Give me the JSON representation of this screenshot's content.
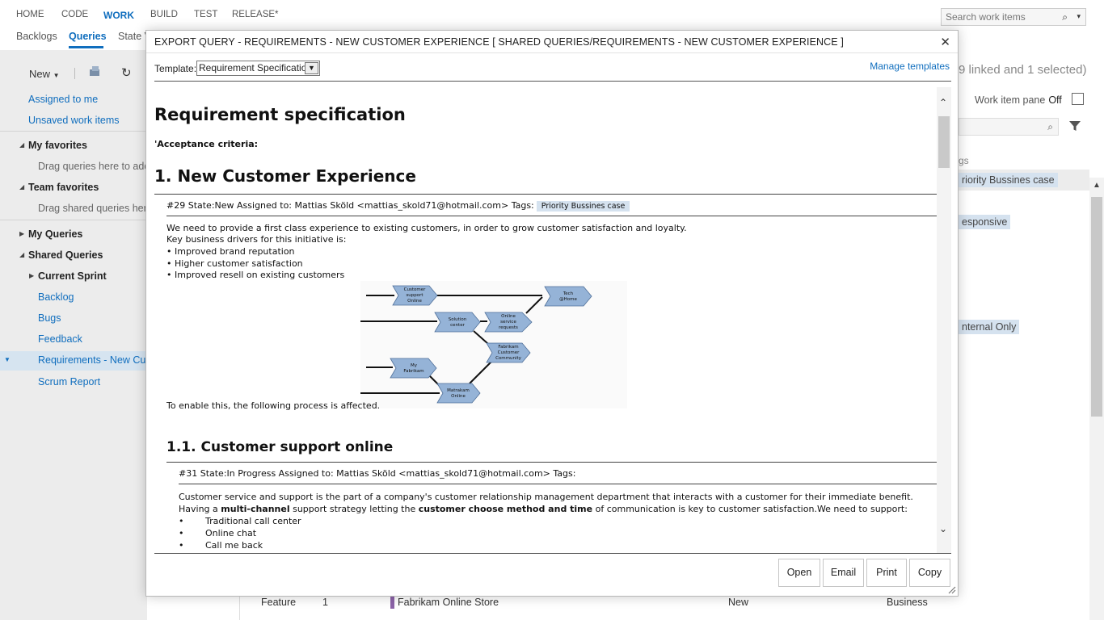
{
  "topnav": {
    "items": [
      "HOME",
      "CODE",
      "WORK",
      "BUILD",
      "TEST",
      "RELEASE*"
    ]
  },
  "search": {
    "placeholder": "Search work items"
  },
  "subnav": {
    "items": [
      "Backlogs",
      "Queries",
      "State V"
    ]
  },
  "sidebar": {
    "new_label": "New",
    "assigned_to_me": "Assigned to me",
    "unsaved": "Unsaved work items",
    "my_favorites": "My favorites",
    "my_fav_hint": "Drag queries here to add",
    "team_favorites": "Team favorites",
    "team_fav_hint": "Drag shared queries here",
    "my_queries": "My Queries",
    "shared_queries": "Shared Queries",
    "current_sprint": "Current Sprint",
    "backlog": "Backlog",
    "bugs": "Bugs",
    "feedback": "Feedback",
    "requirements": "Requirements - New Cus",
    "scrum_report": "Scrum Report"
  },
  "rightpane": {
    "count_text": "9 linked and 1 selected)",
    "wip_label": "Work item pane",
    "wip_value": "Off",
    "tags_header": "gs",
    "tag1": "riority Bussines case",
    "tag2": "esponsive",
    "tag3": "nternal Only"
  },
  "list": {
    "type": "Feature",
    "id": "1",
    "title": "Fabrikam Online Store",
    "state": "New",
    "area": "Business"
  },
  "dialog": {
    "title": "EXPORT QUERY - REQUIREMENTS - NEW CUSTOMER EXPERIENCE [ SHARED QUERIES/REQUIREMENTS - NEW CUSTOMER EXPERIENCE ]",
    "template_label": "Template:",
    "template_value": "Requirement Specification",
    "manage_templates": "Manage templates",
    "buttons": {
      "open": "Open",
      "email": "Email",
      "print": "Print",
      "copy": "Copy"
    }
  },
  "doc": {
    "h1": "Requirement specification",
    "acceptance": "'Acceptance criteria:",
    "h2": "1. New Customer Experience",
    "meta1": "#29 State:New Assigned to: Mattias Sköld <mattias_skold71@hotmail.com> Tags:",
    "meta1_tag": "Priority Bussines case",
    "p1": "We need to provide a first class experience to existing customers, in order to grow customer satisfaction and loyalty.",
    "p2": "Key business drivers for this initiative is:",
    "p3": "• Improved brand reputation",
    "p4": "• Higher customer satisfaction",
    "p5": "• Improved resell on existing customers",
    "p6": "To enable this, the following process is affected.",
    "diagram": {
      "customer_support": [
        "Customer",
        "support",
        "Online"
      ],
      "tech_home": [
        "Tech",
        "@Home"
      ],
      "solution_center": [
        "Solution",
        "center"
      ],
      "online_service": [
        "Online",
        "service",
        "requests"
      ],
      "fabrikam_community": [
        "Fabrikam",
        "Customer",
        "Community"
      ],
      "my_fabrikam": [
        "My",
        "Fabrikam"
      ],
      "matrakam_online": [
        "Matrakam",
        "Online"
      ]
    },
    "h3": "1.1. Customer support online",
    "meta2": "#31 State:In Progress Assigned to: Mattias Sköld <mattias_skold71@hotmail.com> Tags:",
    "p7a": "Customer service and support is the part of a company's customer relationship management department that interacts with a customer for their immediate benefit. Having a ",
    "p7b": "multi-channel",
    "p7c": " support strategy letting the ",
    "p7d": "customer choose method and time",
    "p7e": " of communication is key to customer satisfaction.We need to support:",
    "bullets": [
      "Traditional call center",
      "Online chat",
      "Call me back"
    ]
  }
}
